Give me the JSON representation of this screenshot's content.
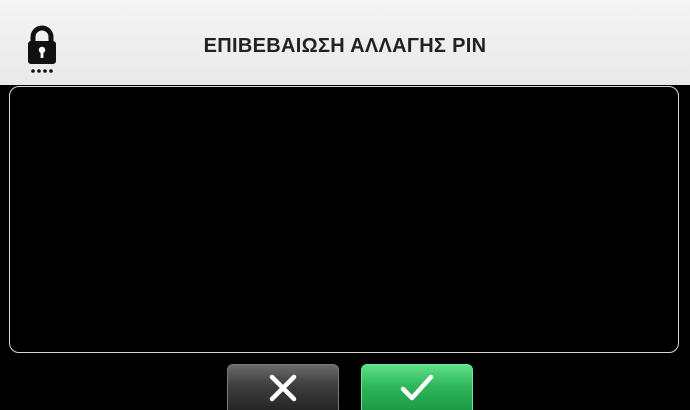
{
  "header": {
    "title": "ΕΠΙΒΕΒΑΙΩΣΗ ΑΛΛΑΓΗΣ PIN",
    "icon": "lock-icon"
  },
  "content": {
    "text": ""
  },
  "buttons": {
    "cancel_icon": "close-icon",
    "confirm_icon": "checkmark-icon"
  },
  "colors": {
    "header_bg": "#efefef",
    "screen_bg": "#000000",
    "confirm_green": "#2fb85c",
    "cancel_gray": "#3e3e3e"
  }
}
